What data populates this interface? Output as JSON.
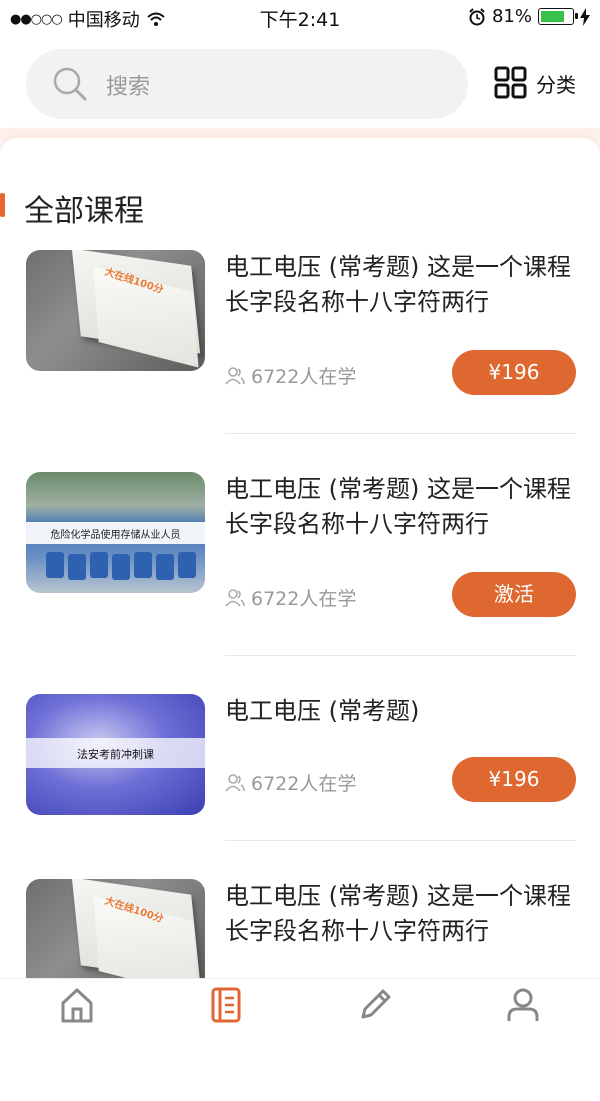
{
  "status_bar": {
    "carrier": "中国移动",
    "time": "下午2:41",
    "battery_percent": "81%",
    "battery_level": 0.81,
    "icons": [
      "signal-dots-icon",
      "wifi-icon",
      "alarm-icon",
      "battery-icon",
      "charging-icon"
    ]
  },
  "search": {
    "placeholder": "搜索",
    "icon": "search-icon"
  },
  "category": {
    "label": "分类",
    "icon": "grid-icon"
  },
  "section": {
    "title": "全部课程",
    "accent_color": "#e8692f"
  },
  "courses": [
    {
      "title": "电工电压 (常考题) 这是一个课程长字段名称十八字符两行",
      "learners": "6722人在学",
      "action": "¥196",
      "thumb": "book"
    },
    {
      "title": "电工电压 (常考题) 这是一个课程长字段名称十八字符两行",
      "learners": "6722人在学",
      "action": "激活",
      "thumb": "chem",
      "thumb_text": "危险化学品使用存储从业人员"
    },
    {
      "title": "电工电压 (常考题)",
      "learners": "6722人在学",
      "action": "¥196",
      "thumb": "blue",
      "thumb_text": "法安考前冲刺课"
    },
    {
      "title": "电工电压 (常考题) 这是一个课程长字段名称十八字符两行",
      "thumb": "book"
    }
  ],
  "book_mark": "大在线100分",
  "tabbar": {
    "items": [
      {
        "icon": "home-icon"
      },
      {
        "icon": "course-book-icon",
        "active": true
      },
      {
        "icon": "pencil-icon"
      },
      {
        "icon": "user-icon"
      }
    ]
  },
  "colors": {
    "accent": "#df6831",
    "inactive_icon": "#888888"
  }
}
